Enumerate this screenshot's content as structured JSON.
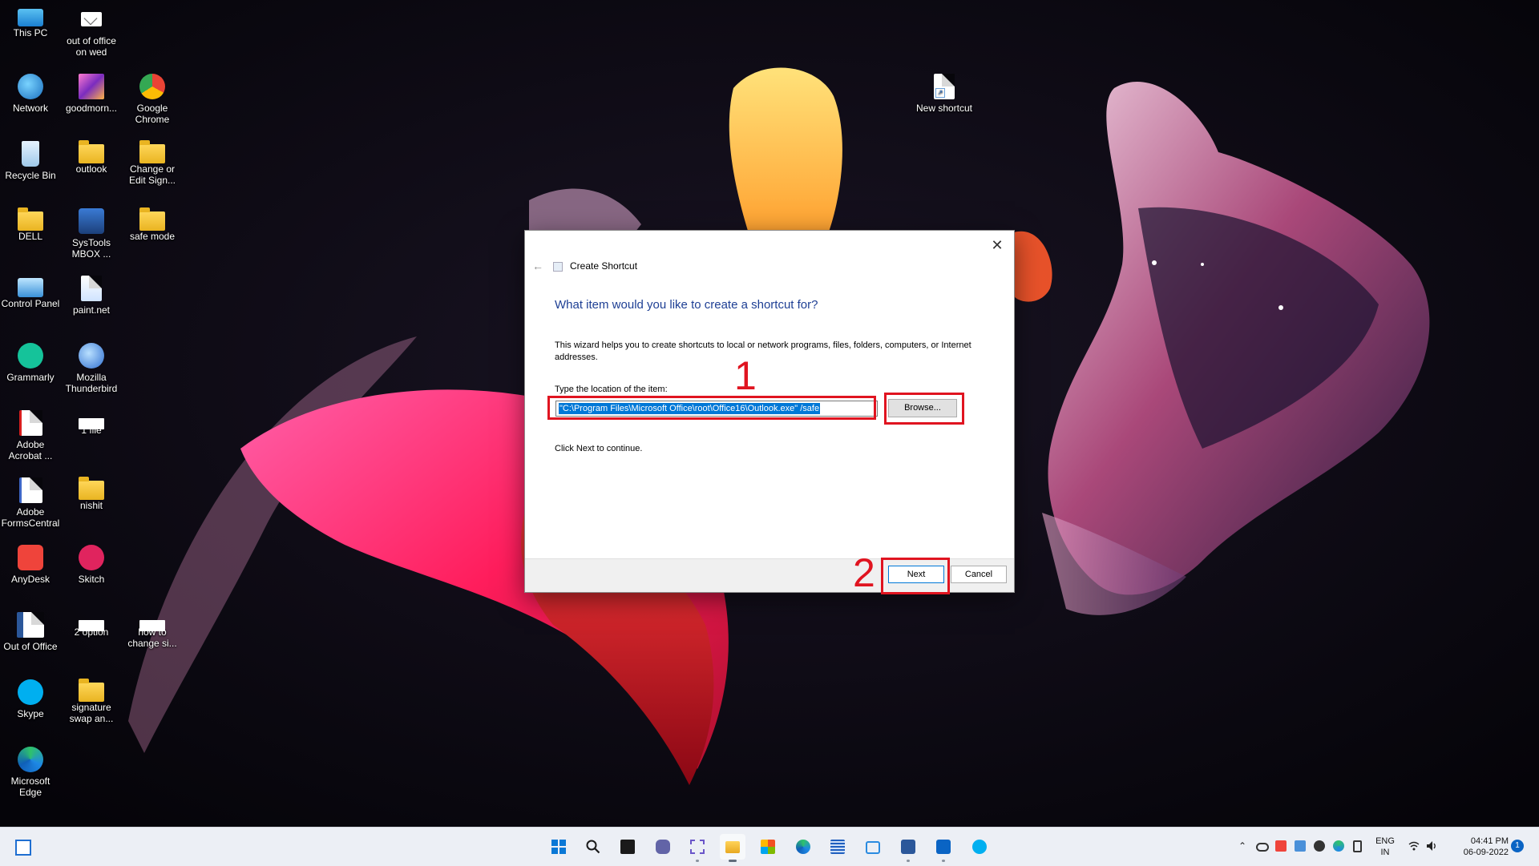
{
  "desktop": {
    "icons": [
      {
        "label": "This PC"
      },
      {
        "label": "out of office on wed"
      },
      {
        "label": "Network"
      },
      {
        "label": "goodmorn..."
      },
      {
        "label": "Google Chrome"
      },
      {
        "label": "Recycle Bin"
      },
      {
        "label": "outlook"
      },
      {
        "label": "Change or Edit Sign..."
      },
      {
        "label": "DELL"
      },
      {
        "label": "SysTools MBOX ..."
      },
      {
        "label": "safe mode"
      },
      {
        "label": "Control Panel"
      },
      {
        "label": "paint.net"
      },
      {
        "label": "Grammarly"
      },
      {
        "label": "Mozilla Thunderbird"
      },
      {
        "label": "Adobe Acrobat ..."
      },
      {
        "label": "1 file"
      },
      {
        "label": "Adobe FormsCentral"
      },
      {
        "label": "nishit"
      },
      {
        "label": "AnyDesk"
      },
      {
        "label": "Skitch"
      },
      {
        "label": "Out of Office"
      },
      {
        "label": "2 option"
      },
      {
        "label": "how to change si..."
      },
      {
        "label": "Skype"
      },
      {
        "label": "signature swap an..."
      },
      {
        "label": "Microsoft Edge"
      },
      {
        "label": "New shortcut"
      }
    ]
  },
  "dialog": {
    "close_glyph": "✕",
    "back_glyph": "←",
    "title": "Create Shortcut",
    "heading": "What item would you like to create a shortcut for?",
    "description": "This wizard helps you to create shortcuts to local or network programs, files, folders, computers, or Internet addresses.",
    "location_label": "Type the location of the item:",
    "location_value": "\"C:\\Program Files\\Microsoft Office\\root\\Office16\\Outlook.exe\" /safe",
    "browse_label": "Browse...",
    "continue_text": "Click Next to continue.",
    "next_label": "Next",
    "cancel_label": "Cancel"
  },
  "annotations": {
    "step1": "1",
    "step2": "2",
    "color": "#e01420"
  },
  "taskbar": {
    "apps": [
      {
        "name": "widgets-icon"
      },
      {
        "name": "start-icon"
      },
      {
        "name": "search-icon"
      },
      {
        "name": "task-view-icon"
      },
      {
        "name": "teams-chat-icon"
      },
      {
        "name": "snipping-tool-icon"
      },
      {
        "name": "file-explorer-icon"
      },
      {
        "name": "microsoft-store-icon"
      },
      {
        "name": "edge-icon"
      },
      {
        "name": "notepad-icon"
      },
      {
        "name": "remote-desktop-icon"
      },
      {
        "name": "word-icon"
      },
      {
        "name": "outlook-icon"
      },
      {
        "name": "skype-icon"
      }
    ],
    "tray": {
      "language_line1": "ENG",
      "language_line2": "IN",
      "time": "04:41 PM",
      "date": "06-09-2022",
      "notification_count": "1"
    },
    "accent": "#0078d7"
  }
}
